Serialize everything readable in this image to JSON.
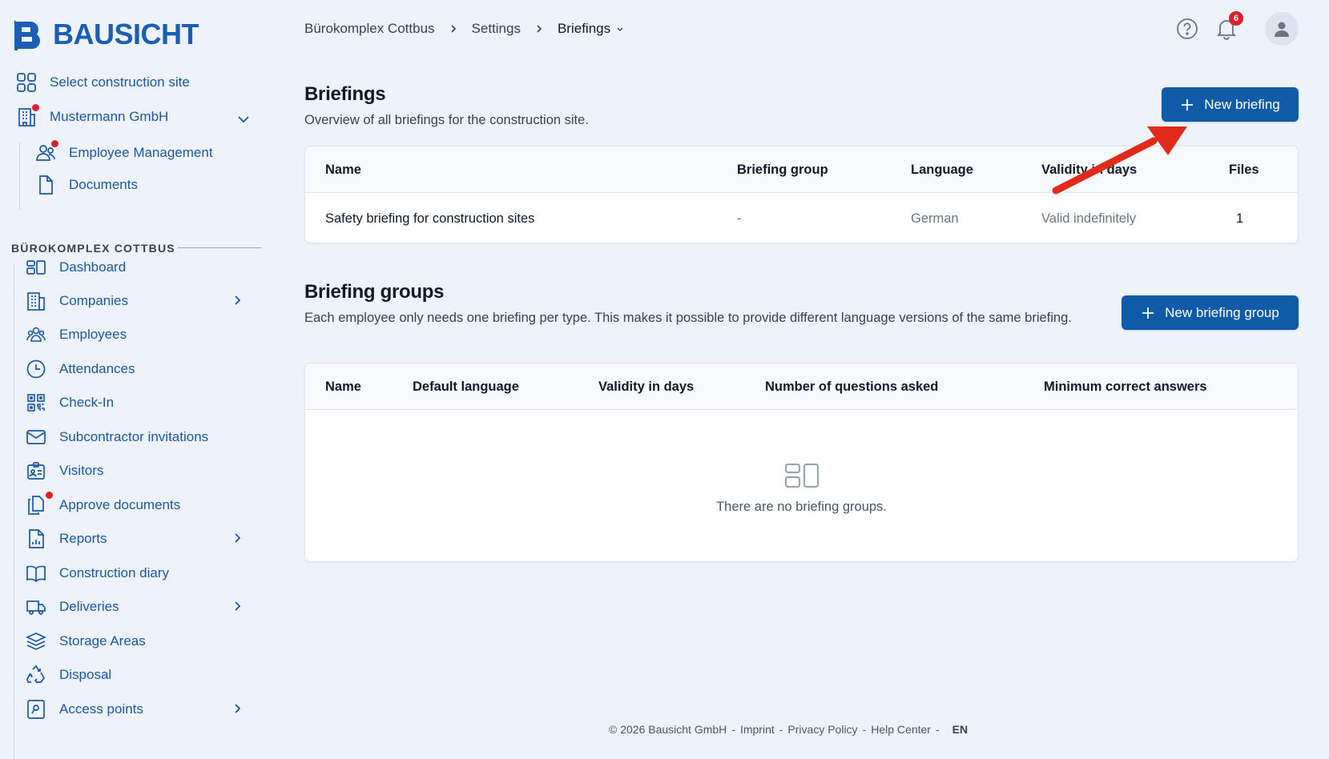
{
  "app": {
    "brand": "BAUSICHT",
    "brand_color": "#1a5fb4",
    "accent": "#0f5ba7"
  },
  "sidebar": {
    "select_site": "Select construction site",
    "company": "Mustermann GmbH",
    "company_items": [
      {
        "label": "Employee Management",
        "icon": "users-icon",
        "dot": true
      },
      {
        "label": "Documents",
        "icon": "document-icon",
        "dot": false
      }
    ],
    "section_title": "BÜROKOMPLEX COTTBUS",
    "items": [
      {
        "label": "Dashboard",
        "icon": "dashboard-icon",
        "chevron": false,
        "dot": false
      },
      {
        "label": "Companies",
        "icon": "building-icon",
        "chevron": true,
        "dot": false
      },
      {
        "label": "Employees",
        "icon": "people-icon",
        "chevron": false,
        "dot": false
      },
      {
        "label": "Attendances",
        "icon": "clock-icon",
        "chevron": false,
        "dot": false
      },
      {
        "label": "Check-In",
        "icon": "qr-code-icon",
        "chevron": false,
        "dot": false
      },
      {
        "label": "Subcontractor invitations",
        "icon": "envelope-icon",
        "chevron": false,
        "dot": false
      },
      {
        "label": "Visitors",
        "icon": "id-card-icon",
        "chevron": false,
        "dot": false
      },
      {
        "label": "Approve documents",
        "icon": "documents-copy-icon",
        "chevron": false,
        "dot": true
      },
      {
        "label": "Reports",
        "icon": "report-icon",
        "chevron": true,
        "dot": false
      },
      {
        "label": "Construction diary",
        "icon": "book-icon",
        "chevron": false,
        "dot": false
      },
      {
        "label": "Deliveries",
        "icon": "truck-icon",
        "chevron": true,
        "dot": false
      },
      {
        "label": "Storage Areas",
        "icon": "layers-icon",
        "chevron": false,
        "dot": false
      },
      {
        "label": "Disposal",
        "icon": "recycle-icon",
        "chevron": false,
        "dot": false
      },
      {
        "label": "Access points",
        "icon": "access-card-icon",
        "chevron": true,
        "dot": false
      }
    ]
  },
  "header": {
    "breadcrumb": [
      "Bürokomplex Cottbus",
      "Settings",
      "Briefings"
    ],
    "notification_count": "6"
  },
  "briefings": {
    "title": "Briefings",
    "description": "Overview of all briefings for the construction site.",
    "new_button": "New briefing",
    "columns": [
      "Name",
      "Briefing group",
      "Language",
      "Validity in days",
      "Files"
    ],
    "rows": [
      {
        "name": "Safety briefing for construction sites",
        "group": "-",
        "language": "German",
        "validity": "Valid indefinitely",
        "files": "1"
      }
    ]
  },
  "briefing_groups": {
    "title": "Briefing groups",
    "description": "Each employee only needs one briefing per type. This makes it possible to provide different language versions of the same briefing.",
    "new_button": "New briefing group",
    "columns": [
      "Name",
      "Default language",
      "Validity in days",
      "Number of questions asked",
      "Minimum correct answers"
    ],
    "empty_text": "There are no briefing groups."
  },
  "footer": {
    "copyright": "© 2026 Bausicht GmbH",
    "links": [
      "Imprint",
      "Privacy Policy",
      "Help Center"
    ],
    "language": "EN"
  }
}
